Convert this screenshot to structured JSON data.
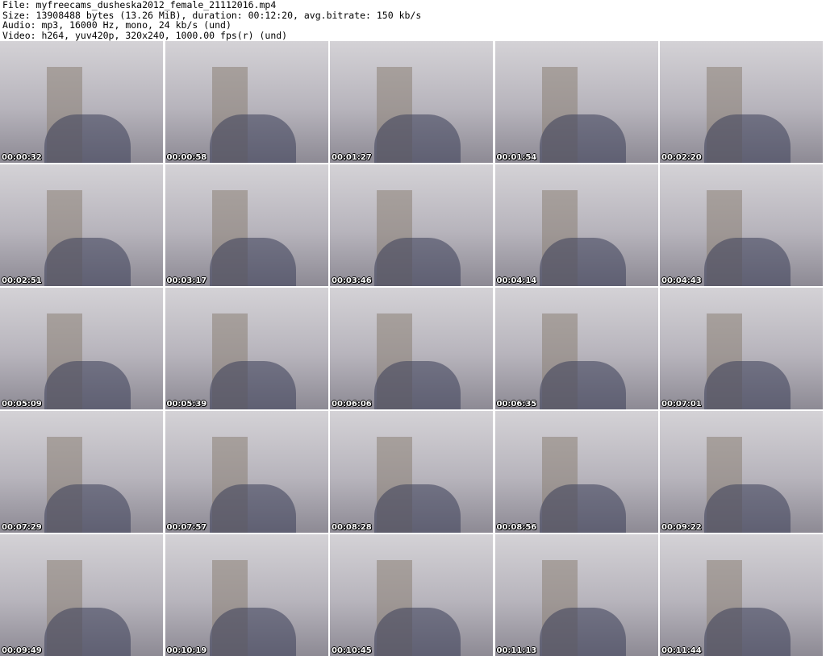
{
  "header": {
    "file_line": "File: myfreecams_dusheska2012_female_21112016.mp4",
    "size_line": "Size: 13908488 bytes (13.26 MiB), duration: 00:12:20, avg.bitrate: 150 kb/s",
    "audio_line": "Audio: mp3, 16000 Hz, mono, 24 kb/s (und)",
    "video_line": "Video: h264, yuv420p, 320x240, 1000.00 fps(r) (und)"
  },
  "thumbnails": [
    {
      "timestamp": "00:00:32"
    },
    {
      "timestamp": "00:00:58"
    },
    {
      "timestamp": "00:01:27"
    },
    {
      "timestamp": "00:01:54"
    },
    {
      "timestamp": "00:02:20"
    },
    {
      "timestamp": "00:02:51"
    },
    {
      "timestamp": "00:03:17"
    },
    {
      "timestamp": "00:03:46"
    },
    {
      "timestamp": "00:04:14"
    },
    {
      "timestamp": "00:04:43"
    },
    {
      "timestamp": "00:05:09"
    },
    {
      "timestamp": "00:05:39"
    },
    {
      "timestamp": "00:06:06"
    },
    {
      "timestamp": "00:06:35"
    },
    {
      "timestamp": "00:07:01"
    },
    {
      "timestamp": "00:07:29"
    },
    {
      "timestamp": "00:07:57"
    },
    {
      "timestamp": "00:08:28"
    },
    {
      "timestamp": "00:08:56"
    },
    {
      "timestamp": "00:09:22"
    },
    {
      "timestamp": "00:09:49"
    },
    {
      "timestamp": "00:10:19"
    },
    {
      "timestamp": "00:10:45"
    },
    {
      "timestamp": "00:11:13"
    },
    {
      "timestamp": "00:11:44"
    }
  ]
}
